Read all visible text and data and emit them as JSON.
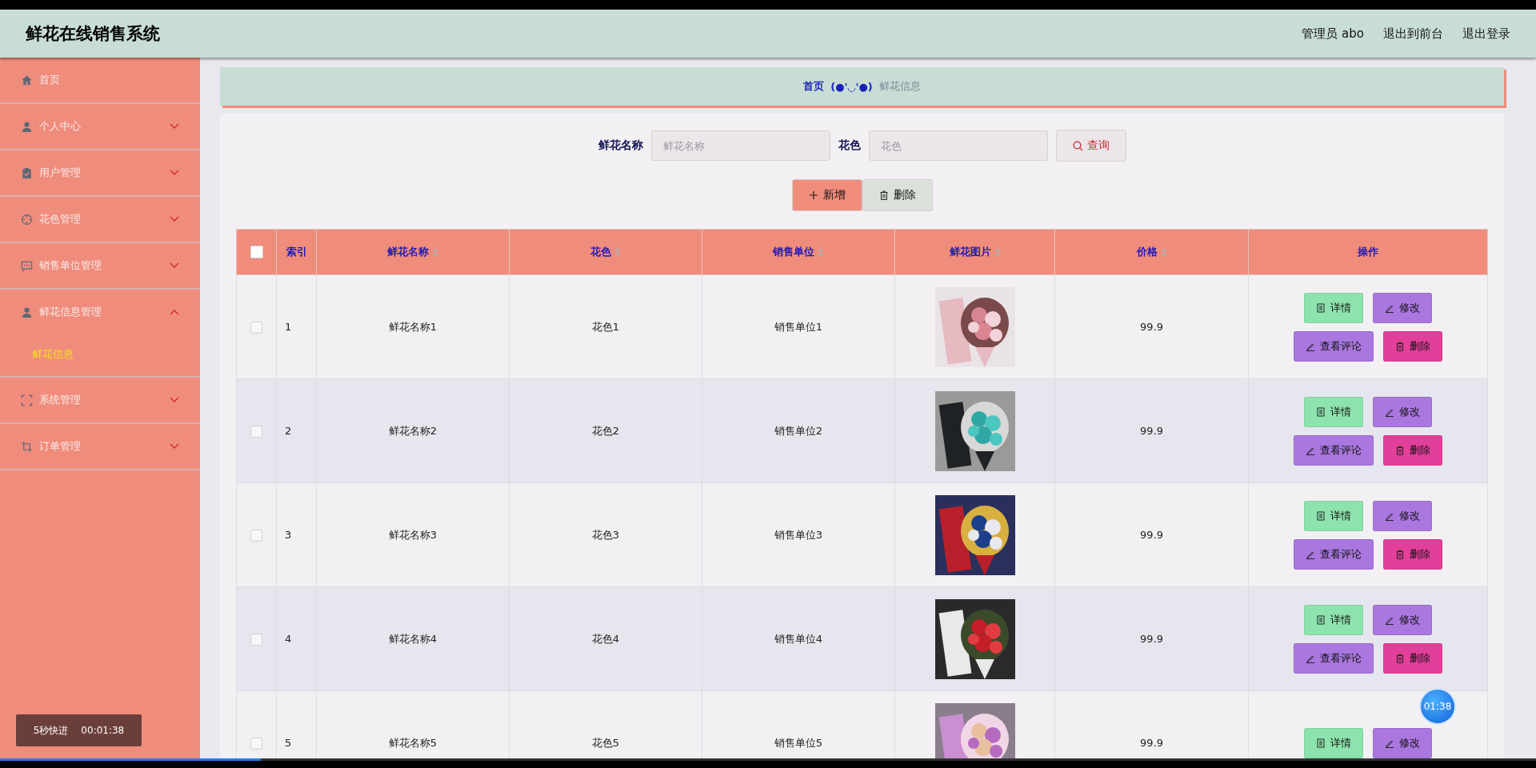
{
  "header": {
    "title": "鲜花在线销售系统",
    "links": [
      "管理员 abo",
      "退出到前台",
      "退出登录"
    ]
  },
  "sidebar": {
    "items": [
      {
        "label": "首页"
      },
      {
        "label": "个人中心",
        "expanded": false
      },
      {
        "label": "用户管理",
        "expanded": false
      },
      {
        "label": "花色管理",
        "expanded": false
      },
      {
        "label": "销售单位管理",
        "expanded": false
      },
      {
        "label": "鲜花信息管理",
        "expanded": true,
        "children": [
          {
            "label": "鲜花信息",
            "selected": true
          }
        ]
      },
      {
        "label": "系统管理",
        "expanded": false
      },
      {
        "label": "订单管理",
        "expanded": false
      }
    ]
  },
  "breadcrumb": {
    "home": "首页",
    "separator": "(●'◡'●)",
    "current": "鲜花信息"
  },
  "search": {
    "fields": [
      {
        "label": "鲜花名称",
        "placeholder": "鲜花名称"
      },
      {
        "label": "花色",
        "placeholder": "花色"
      }
    ],
    "button": "查询"
  },
  "toolbar": [
    {
      "label": "新增",
      "kind": "add"
    },
    {
      "label": "删除",
      "kind": "delete"
    }
  ],
  "table": {
    "header_checked": false,
    "columns": [
      {
        "label": "索引",
        "sortable": false
      },
      {
        "label": "鲜花名称",
        "sortable": true
      },
      {
        "label": "花色",
        "sortable": true
      },
      {
        "label": "销售单位",
        "sortable": true
      },
      {
        "label": "鲜花图片",
        "sortable": true
      },
      {
        "label": "价格",
        "sortable": true
      },
      {
        "label": "操作",
        "sortable": false
      }
    ],
    "rows": [
      {
        "checked": false,
        "index": "1",
        "name": "鲜花名称1",
        "flower_color": "花色1",
        "unit": "销售单位1",
        "image": {
          "kind": "picture"
        },
        "price": "99.9",
        "actions": [
          {
            "label": "详情",
            "kind": "detail"
          },
          {
            "label": "修改",
            "kind": "edit"
          },
          {
            "label": "查看评论",
            "kind": "comment"
          },
          {
            "label": "删除",
            "kind": "delete"
          }
        ]
      },
      {
        "checked": false,
        "index": "2",
        "name": "鲜花名称2",
        "flower_color": "花色2",
        "unit": "销售单位2",
        "image": {
          "kind": "picture"
        },
        "price": "99.9",
        "actions": [
          {
            "label": "详情",
            "kind": "detail"
          },
          {
            "label": "修改",
            "kind": "edit"
          },
          {
            "label": "查看评论",
            "kind": "comment"
          },
          {
            "label": "删除",
            "kind": "delete"
          }
        ]
      },
      {
        "checked": false,
        "index": "3",
        "name": "鲜花名称3",
        "flower_color": "花色3",
        "unit": "销售单位3",
        "image": {
          "kind": "picture"
        },
        "price": "99.9",
        "actions": [
          {
            "label": "详情",
            "kind": "detail"
          },
          {
            "label": "修改",
            "kind": "edit"
          },
          {
            "label": "查看评论",
            "kind": "comment"
          },
          {
            "label": "删除",
            "kind": "delete"
          }
        ]
      },
      {
        "checked": false,
        "index": "4",
        "name": "鲜花名称4",
        "flower_color": "花色4",
        "unit": "销售单位4",
        "image": {
          "kind": "picture"
        },
        "price": "99.9",
        "actions": [
          {
            "label": "详情",
            "kind": "detail"
          },
          {
            "label": "修改",
            "kind": "edit"
          },
          {
            "label": "查看评论",
            "kind": "comment"
          },
          {
            "label": "删除",
            "kind": "delete"
          }
        ]
      },
      {
        "checked": false,
        "index": "5",
        "name": "鲜花名称5",
        "flower_color": "花色5",
        "unit": "销售单位5",
        "image": {
          "kind": "picture"
        },
        "price": "99.9",
        "actions": [
          {
            "label": "详情",
            "kind": "detail"
          },
          {
            "label": "修改",
            "kind": "edit"
          }
        ]
      }
    ]
  },
  "player": {
    "toast": {
      "label": "5秒快进",
      "time": "00:01:38"
    },
    "timer": "01:38",
    "progress": {
      "level": 0.17
    }
  }
}
